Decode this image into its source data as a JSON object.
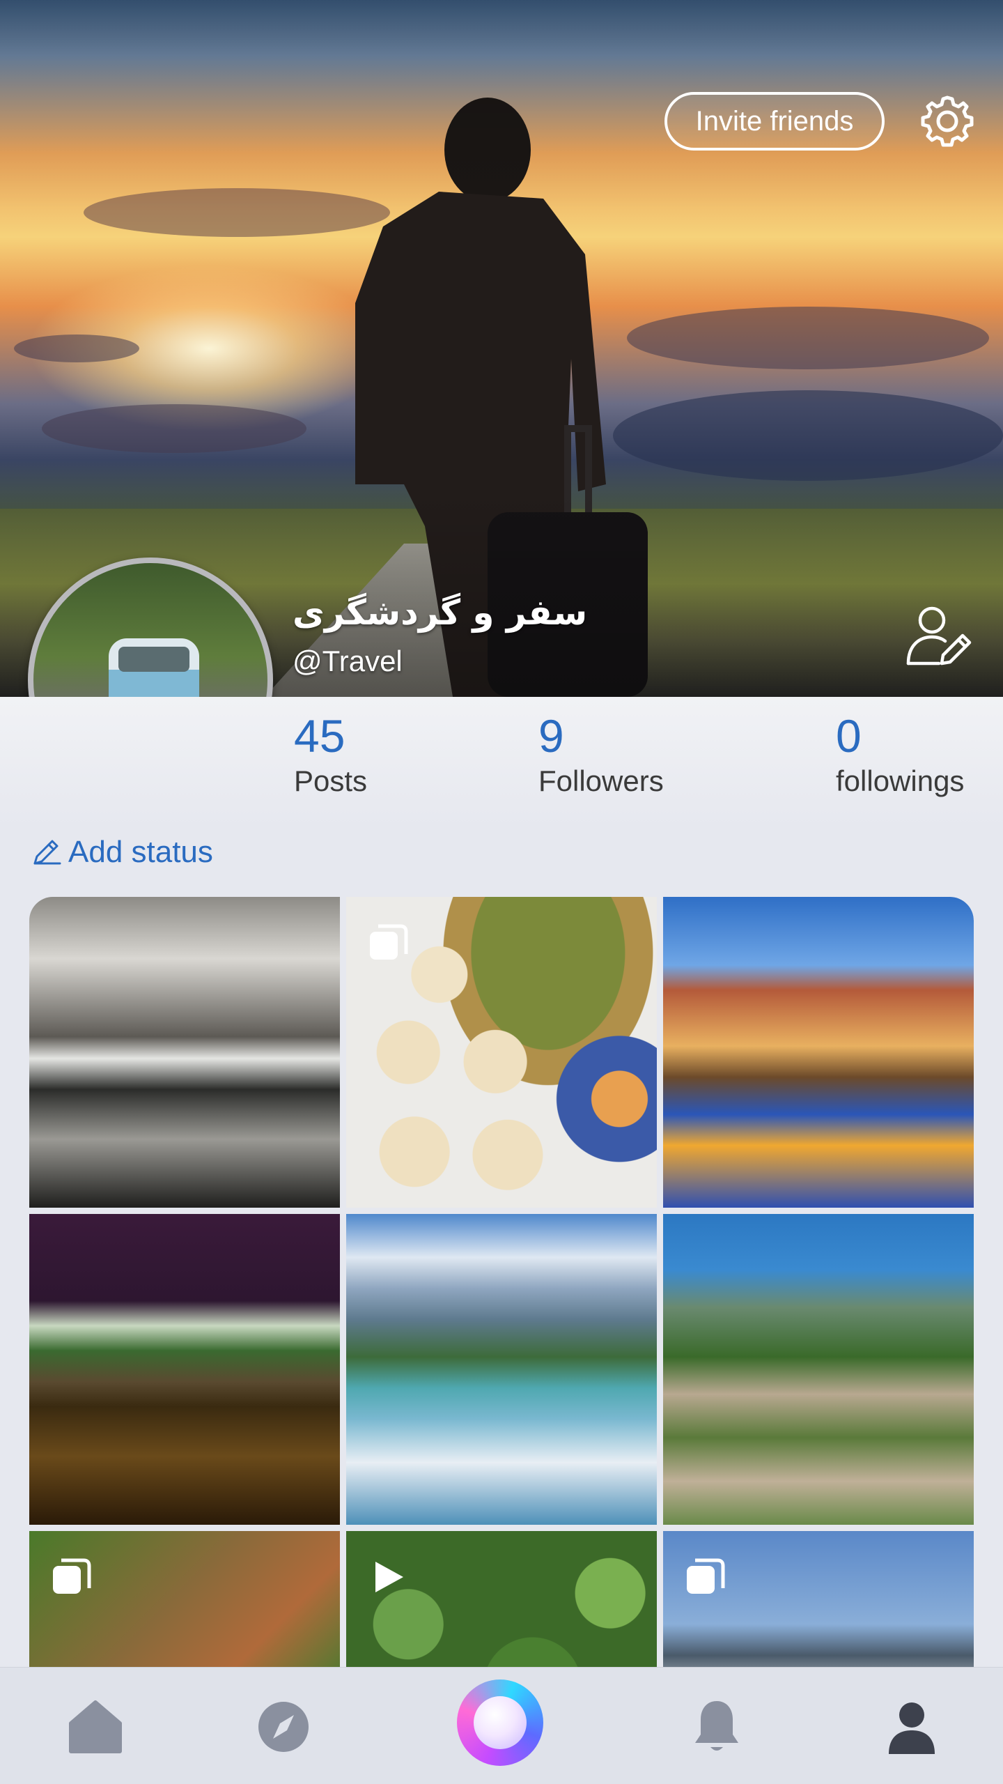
{
  "header": {
    "invite_label": "Invite friends",
    "settings_icon": "gear-icon",
    "edit_profile_icon": "user-edit-icon"
  },
  "profile": {
    "name": "سفر و گردشگری",
    "handle": "@Travel"
  },
  "stats": [
    {
      "value": "45",
      "label": "Posts"
    },
    {
      "value": "9",
      "label": "Followers"
    },
    {
      "value": "0",
      "label": "followings"
    }
  ],
  "status": {
    "label": "Add status",
    "icon": "pencil-icon"
  },
  "posts": [
    {
      "subject": "cave lake",
      "badge": ""
    },
    {
      "subject": "pastries",
      "badge": "multi"
    },
    {
      "subject": "bridge at night",
      "badge": ""
    },
    {
      "subject": "palm shore at night",
      "badge": ""
    },
    {
      "subject": "mountain lake",
      "badge": ""
    },
    {
      "subject": "city bay statue",
      "badge": ""
    },
    {
      "subject": "hillside village",
      "badge": "multi"
    },
    {
      "subject": "forest",
      "badge": "video"
    },
    {
      "subject": "harbor town",
      "badge": "multi"
    }
  ],
  "nav": [
    "home-icon",
    "compass-icon",
    "orb-button",
    "bell-icon",
    "profile-icon"
  ],
  "colors": {
    "accent": "#2a6bc0",
    "nav_icon": "#8a909f",
    "background": "#e6e8ef"
  }
}
